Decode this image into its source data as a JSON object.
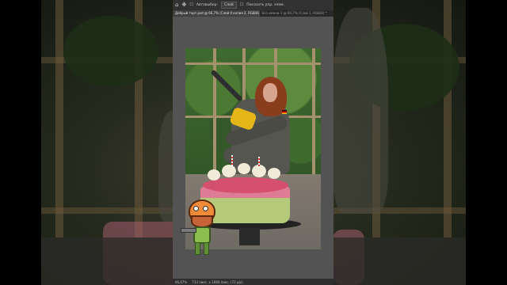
{
  "app": {
    "name": "Adobe Photoshop",
    "toolbar": {
      "home_icon": "home-icon",
      "move_icon": "move-icon",
      "auto_select_label": "Автовыбор:",
      "auto_select_value": "Слой",
      "show_controls_label": "Показать упр. элем."
    },
    "tabs": [
      {
        "label": "Добрый торт.psd @ 66,7% (Слой 0 копия 2, RGB/8) *",
        "active": true
      },
      {
        "label": "Без имени-1 @ 66,7% (Слой 1, RGB/8) *",
        "active": false
      }
    ],
    "status": {
      "zoom": "66,67%",
      "dimensions": "733 пикс. x 1080 пикс. (72 ppi)"
    }
  },
  "colors": {
    "ps_canvas_bg": "#535353",
    "ps_bar": "#323232",
    "ps_tab_active": "#404040"
  }
}
